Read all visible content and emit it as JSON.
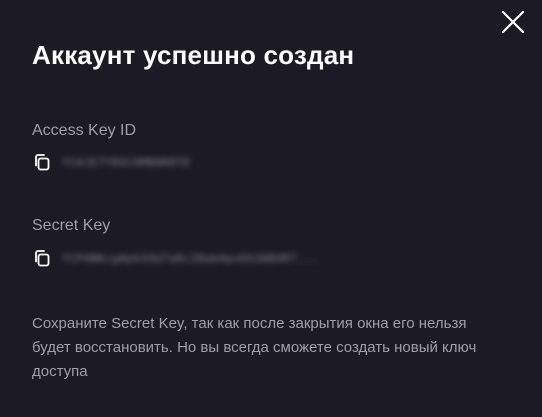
{
  "modal": {
    "title": "Аккаунт успешно создан",
    "close_icon": "close-icon"
  },
  "access_key": {
    "label": "Access Key ID",
    "value": "YCAJE7Y8XCOMB8R8TD",
    "icon": "copy-icon"
  },
  "secret_key": {
    "label": "Secret Key",
    "value": "YCP4BKcgApkX4d7a8cZ8ab4pxEb3AB4R7...",
    "icon": "copy-icon"
  },
  "note": "Сохраните Secret Key, так как после закрытия окна его нельзя будет восстановить. Но вы всегда сможете создать новый ключ доступа",
  "colors": {
    "background": "#1c1a22",
    "title": "#ffffff",
    "muted_text": "#a19eab",
    "icon": "#ffffff"
  }
}
